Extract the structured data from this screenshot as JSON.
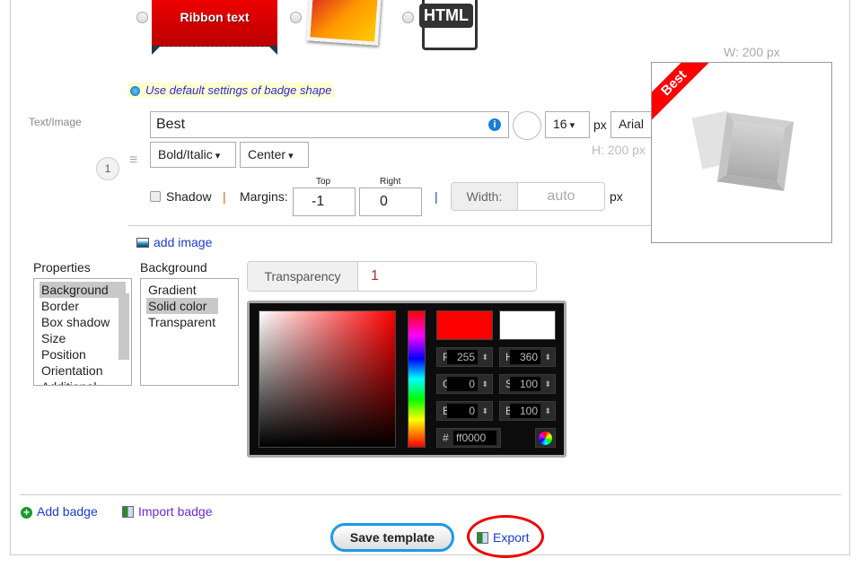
{
  "shapes": {
    "ribbon_label": "Ribbon text",
    "html_label": "HTML"
  },
  "default_settings": "Use default settings of badge shape",
  "text_image_label": "Text/Image",
  "badge_index": "1",
  "text_value": "Best",
  "font_size": "16",
  "px": "px",
  "font_family": "Arial",
  "style": "Bold/Italic",
  "align": "Center",
  "shadow": "Shadow",
  "margins_label": "Margins:",
  "margin_top_label": "Top",
  "margin_top": "-1",
  "margin_right_label": "Right",
  "margin_right": "0",
  "width_label": "Width:",
  "width_placeholder": "auto",
  "add_image": "add image",
  "preview": {
    "width": "W: 200 px",
    "height": "H: 200 px",
    "badge_text": "Best",
    "badge_color": "#ff0000"
  },
  "properties": {
    "label": "Properties",
    "items": [
      "Background",
      "Border",
      "Box shadow",
      "Size",
      "Position",
      "Orientation",
      "Additional"
    ],
    "selected": "Background"
  },
  "background": {
    "label": "Background",
    "items": [
      "Gradient",
      "Solid color",
      "Transparent"
    ],
    "selected": "Solid color"
  },
  "transparency": {
    "label": "Transparency",
    "value": "1"
  },
  "color": {
    "r": "255",
    "g": "0",
    "b": "0",
    "h": "360",
    "s": "100",
    "br": "100",
    "hex": "ff0000",
    "current": "#ff0000",
    "previous": "#ffffff",
    "labels": {
      "r": "R",
      "g": "G",
      "b": "B",
      "h": "H",
      "s": "S",
      "br": "B",
      "hash": "#"
    }
  },
  "footer": {
    "add_badge": "Add badge",
    "import_badge": "Import badge",
    "save_template": "Save template",
    "export": "Export"
  }
}
